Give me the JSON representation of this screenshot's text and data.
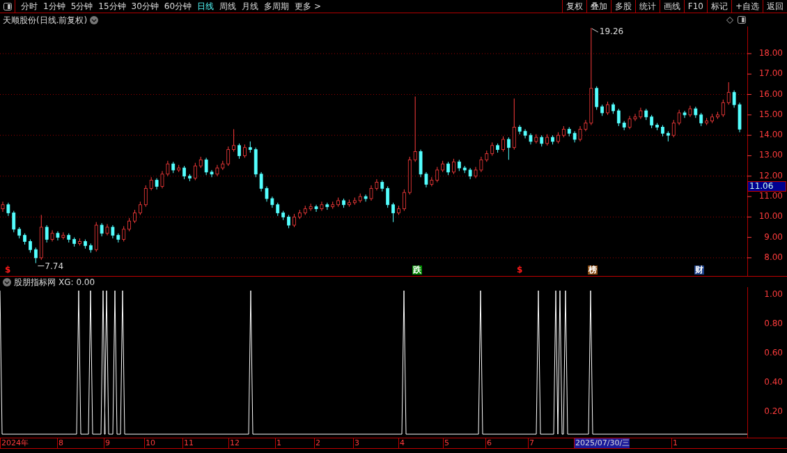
{
  "toolbar": {
    "periods": [
      {
        "label": "分时",
        "selected": false
      },
      {
        "label": "1分钟",
        "selected": false
      },
      {
        "label": "5分钟",
        "selected": false
      },
      {
        "label": "15分钟",
        "selected": false
      },
      {
        "label": "30分钟",
        "selected": false
      },
      {
        "label": "60分钟",
        "selected": false
      },
      {
        "label": "日线",
        "selected": true
      },
      {
        "label": "周线",
        "selected": false
      },
      {
        "label": "月线",
        "selected": false
      },
      {
        "label": "多周期",
        "selected": false
      },
      {
        "label": "更多 >",
        "selected": false
      }
    ],
    "buttons": [
      "复权",
      "叠加",
      "多股",
      "统计",
      "画线",
      "F10",
      "标记",
      "+自选",
      "返回"
    ]
  },
  "price_chart": {
    "title": "天顺股份(日线.前复权)",
    "chart_data": {
      "type": "candlestick",
      "ylim": [
        7.11,
        19.33
      ],
      "grid": true,
      "yticks": [
        {
          "value": 18,
          "label": "18.00"
        },
        {
          "value": 17,
          "label": "17.00"
        },
        {
          "value": 16,
          "label": "16.00"
        },
        {
          "value": 15,
          "label": "15.00"
        },
        {
          "value": 14,
          "label": "14.00"
        },
        {
          "value": 13,
          "label": "13.00"
        },
        {
          "value": 12,
          "label": "12.00"
        },
        {
          "value": 11,
          "label": "11.00"
        },
        {
          "value": 10,
          "label": "10.00"
        },
        {
          "value": 9,
          "label": "9.00"
        },
        {
          "value": 8,
          "label": "8.00"
        }
      ],
      "ohlc": [
        [
          10.4,
          10.75,
          10.25,
          10.6
        ],
        [
          10.6,
          10.7,
          10.05,
          10.2
        ],
        [
          10.2,
          10.3,
          9.25,
          9.4
        ],
        [
          9.4,
          9.5,
          8.95,
          9.1
        ],
        [
          9.1,
          9.2,
          8.65,
          8.8
        ],
        [
          8.8,
          8.9,
          8.25,
          8.4
        ],
        [
          8.4,
          8.5,
          7.74,
          8.0
        ],
        [
          8.0,
          10.1,
          7.9,
          9.5
        ],
        [
          9.5,
          9.6,
          8.75,
          8.9
        ],
        [
          8.9,
          9.35,
          8.8,
          9.2
        ],
        [
          9.2,
          9.3,
          8.85,
          9.0
        ],
        [
          9.0,
          9.25,
          8.9,
          9.1
        ],
        [
          9.1,
          9.2,
          8.75,
          8.9
        ],
        [
          8.9,
          9.0,
          8.55,
          8.7
        ],
        [
          8.7,
          8.95,
          8.6,
          8.8
        ],
        [
          8.8,
          8.9,
          8.45,
          8.6
        ],
        [
          8.6,
          8.7,
          8.25,
          8.4
        ],
        [
          8.4,
          9.75,
          8.3,
          9.6
        ],
        [
          9.6,
          9.7,
          9.05,
          9.2
        ],
        [
          9.2,
          9.65,
          9.1,
          9.5
        ],
        [
          9.5,
          9.6,
          8.95,
          9.1
        ],
        [
          9.1,
          9.2,
          8.75,
          8.9
        ],
        [
          8.9,
          9.55,
          8.8,
          9.4
        ],
        [
          9.4,
          9.95,
          9.3,
          9.8
        ],
        [
          9.8,
          10.35,
          9.7,
          10.2
        ],
        [
          10.2,
          10.75,
          10.1,
          10.6
        ],
        [
          10.6,
          11.55,
          10.5,
          11.4
        ],
        [
          11.4,
          11.95,
          11.3,
          11.8
        ],
        [
          11.8,
          11.9,
          11.35,
          11.5
        ],
        [
          11.5,
          12.25,
          11.4,
          12.1
        ],
        [
          12.1,
          12.75,
          12.0,
          12.6
        ],
        [
          12.6,
          12.7,
          12.15,
          12.3
        ],
        [
          12.3,
          12.55,
          12.2,
          12.4
        ],
        [
          12.4,
          12.5,
          11.85,
          12.0
        ],
        [
          12.0,
          12.1,
          11.75,
          11.9
        ],
        [
          11.9,
          12.65,
          11.8,
          12.5
        ],
        [
          12.5,
          12.95,
          12.4,
          12.8
        ],
        [
          12.8,
          12.9,
          12.05,
          12.2
        ],
        [
          12.2,
          12.3,
          11.95,
          12.1
        ],
        [
          12.1,
          12.55,
          12.0,
          12.4
        ],
        [
          12.4,
          12.75,
          12.3,
          12.6
        ],
        [
          12.6,
          13.45,
          12.5,
          13.3
        ],
        [
          13.3,
          14.3,
          13.2,
          13.5
        ],
        [
          13.5,
          13.6,
          12.85,
          13.0
        ],
        [
          13.0,
          13.55,
          12.9,
          13.4
        ],
        [
          13.4,
          13.7,
          13.15,
          13.3
        ],
        [
          13.3,
          13.4,
          11.95,
          12.1
        ],
        [
          12.1,
          12.2,
          11.25,
          11.4
        ],
        [
          11.4,
          11.5,
          10.75,
          10.9
        ],
        [
          10.9,
          11.0,
          10.45,
          10.6
        ],
        [
          10.6,
          10.7,
          10.05,
          10.2
        ],
        [
          10.2,
          10.3,
          9.85,
          10.0
        ],
        [
          10.0,
          10.1,
          9.45,
          9.6
        ],
        [
          9.6,
          10.15,
          9.5,
          10.0
        ],
        [
          10.0,
          10.35,
          9.9,
          10.2
        ],
        [
          10.2,
          10.55,
          10.1,
          10.4
        ],
        [
          10.4,
          10.65,
          10.3,
          10.5
        ],
        [
          10.5,
          10.6,
          10.25,
          10.4
        ],
        [
          10.4,
          10.75,
          10.3,
          10.6
        ],
        [
          10.6,
          10.7,
          10.35,
          10.5
        ],
        [
          10.5,
          10.75,
          10.4,
          10.6
        ],
        [
          10.6,
          10.95,
          10.5,
          10.8
        ],
        [
          10.8,
          10.9,
          10.45,
          10.6
        ],
        [
          10.6,
          10.85,
          10.5,
          10.7
        ],
        [
          10.7,
          10.95,
          10.6,
          10.8
        ],
        [
          10.8,
          11.15,
          10.7,
          11.0
        ],
        [
          11.0,
          11.1,
          10.75,
          10.9
        ],
        [
          10.9,
          11.55,
          10.8,
          11.4
        ],
        [
          11.4,
          11.85,
          11.3,
          11.7
        ],
        [
          11.7,
          11.8,
          11.25,
          11.4
        ],
        [
          11.4,
          11.5,
          10.45,
          10.6
        ],
        [
          10.6,
          10.7,
          9.75,
          10.2
        ],
        [
          10.2,
          10.55,
          10.1,
          10.4
        ],
        [
          10.4,
          11.35,
          10.3,
          11.2
        ],
        [
          11.2,
          12.95,
          11.1,
          12.8
        ],
        [
          12.8,
          15.9,
          12.7,
          13.2
        ],
        [
          13.2,
          13.3,
          11.95,
          12.1
        ],
        [
          12.1,
          12.2,
          11.45,
          11.6
        ],
        [
          11.6,
          11.95,
          11.5,
          11.8
        ],
        [
          11.8,
          12.45,
          11.7,
          12.3
        ],
        [
          12.3,
          12.75,
          12.2,
          12.6
        ],
        [
          12.6,
          12.7,
          12.05,
          12.2
        ],
        [
          12.2,
          12.85,
          12.1,
          12.7
        ],
        [
          12.7,
          12.8,
          12.25,
          12.4
        ],
        [
          12.4,
          12.5,
          12.15,
          12.3
        ],
        [
          12.3,
          12.4,
          11.85,
          12.0
        ],
        [
          12.0,
          12.45,
          11.9,
          12.3
        ],
        [
          12.3,
          12.95,
          12.2,
          12.8
        ],
        [
          12.8,
          13.25,
          12.7,
          13.1
        ],
        [
          13.1,
          13.65,
          13.0,
          13.5
        ],
        [
          13.5,
          13.6,
          13.15,
          13.3
        ],
        [
          13.3,
          13.95,
          13.2,
          13.8
        ],
        [
          13.8,
          13.9,
          12.8,
          13.4
        ],
        [
          13.4,
          15.8,
          13.3,
          14.4
        ],
        [
          14.4,
          14.5,
          14.05,
          14.2
        ],
        [
          14.2,
          14.3,
          13.85,
          14.0
        ],
        [
          14.0,
          14.1,
          13.55,
          13.7
        ],
        [
          13.7,
          14.05,
          13.6,
          13.9
        ],
        [
          13.9,
          14.0,
          13.45,
          13.6
        ],
        [
          13.6,
          14.05,
          13.5,
          13.9
        ],
        [
          13.9,
          14.0,
          13.55,
          13.7
        ],
        [
          13.7,
          14.15,
          13.6,
          14.0
        ],
        [
          14.0,
          14.45,
          13.9,
          14.3
        ],
        [
          14.3,
          14.4,
          13.95,
          14.1
        ],
        [
          14.1,
          14.2,
          13.65,
          13.8
        ],
        [
          13.8,
          14.45,
          13.7,
          14.3
        ],
        [
          14.3,
          14.75,
          14.2,
          14.6
        ],
        [
          14.6,
          19.26,
          14.5,
          16.3
        ],
        [
          16.3,
          16.4,
          15.25,
          15.4
        ],
        [
          15.4,
          15.5,
          14.95,
          15.1
        ],
        [
          15.1,
          15.65,
          15.0,
          15.5
        ],
        [
          15.5,
          15.6,
          15.05,
          15.2
        ],
        [
          15.2,
          15.3,
          14.45,
          14.6
        ],
        [
          14.6,
          14.7,
          14.25,
          14.4
        ],
        [
          14.4,
          14.95,
          14.3,
          14.8
        ],
        [
          14.8,
          15.05,
          14.7,
          14.9
        ],
        [
          14.9,
          15.35,
          14.8,
          15.2
        ],
        [
          15.2,
          15.3,
          14.75,
          14.9
        ],
        [
          14.9,
          15.0,
          14.35,
          14.5
        ],
        [
          14.5,
          14.6,
          14.25,
          14.4
        ],
        [
          14.4,
          14.5,
          13.95,
          14.1
        ],
        [
          14.1,
          14.2,
          13.7,
          14.0
        ],
        [
          14.0,
          14.75,
          13.9,
          14.6
        ],
        [
          14.6,
          15.25,
          14.5,
          15.1
        ],
        [
          15.1,
          15.2,
          14.85,
          15.0
        ],
        [
          15.0,
          15.45,
          14.9,
          15.3
        ],
        [
          15.3,
          15.4,
          14.85,
          15.0
        ],
        [
          15.0,
          15.1,
          14.45,
          14.6
        ],
        [
          14.6,
          14.85,
          14.5,
          14.7
        ],
        [
          14.7,
          15.05,
          14.6,
          14.9
        ],
        [
          14.9,
          15.15,
          14.8,
          15.0
        ],
        [
          15.0,
          15.75,
          14.9,
          15.6
        ],
        [
          15.6,
          16.6,
          15.5,
          16.1
        ],
        [
          16.1,
          16.2,
          15.35,
          15.5
        ],
        [
          15.5,
          15.6,
          14.15,
          14.3
        ]
      ]
    },
    "last_price": "11.06",
    "high_label": "19.26",
    "low_label": "7.74",
    "events": [
      {
        "label": "$",
        "kind": "mark",
        "color": "#ff1a1a"
      },
      {
        "label": "跌",
        "kind": "tag",
        "color": "#008a00"
      },
      {
        "label": "$",
        "kind": "mark",
        "color": "#ff1a1a"
      },
      {
        "label": "榜",
        "kind": "tag",
        "color": "#8a4a10"
      },
      {
        "label": "财",
        "kind": "tag",
        "color": "#1a3f8a"
      }
    ]
  },
  "indicator": {
    "title": "股朋指标网",
    "reading": "XG: 0.00",
    "axis": [
      "1.00",
      "0.80",
      "0.60",
      "0.40",
      "0.20"
    ]
  },
  "time_axis": [
    {
      "label": "2024年",
      "selected": false
    },
    {
      "label": "8",
      "selected": false
    },
    {
      "label": "9",
      "selected": false
    },
    {
      "label": "10",
      "selected": false
    },
    {
      "label": "11",
      "selected": false
    },
    {
      "label": "12",
      "selected": false
    },
    {
      "label": "1",
      "selected": false
    },
    {
      "label": "2",
      "selected": false
    },
    {
      "label": "3",
      "selected": false
    },
    {
      "label": "4",
      "selected": false
    },
    {
      "label": "5",
      "selected": false
    },
    {
      "label": "6",
      "selected": false
    },
    {
      "label": "7",
      "selected": false
    },
    {
      "label": "2025/07/30/三",
      "selected": true
    },
    {
      "label": "1",
      "selected": false
    }
  ]
}
